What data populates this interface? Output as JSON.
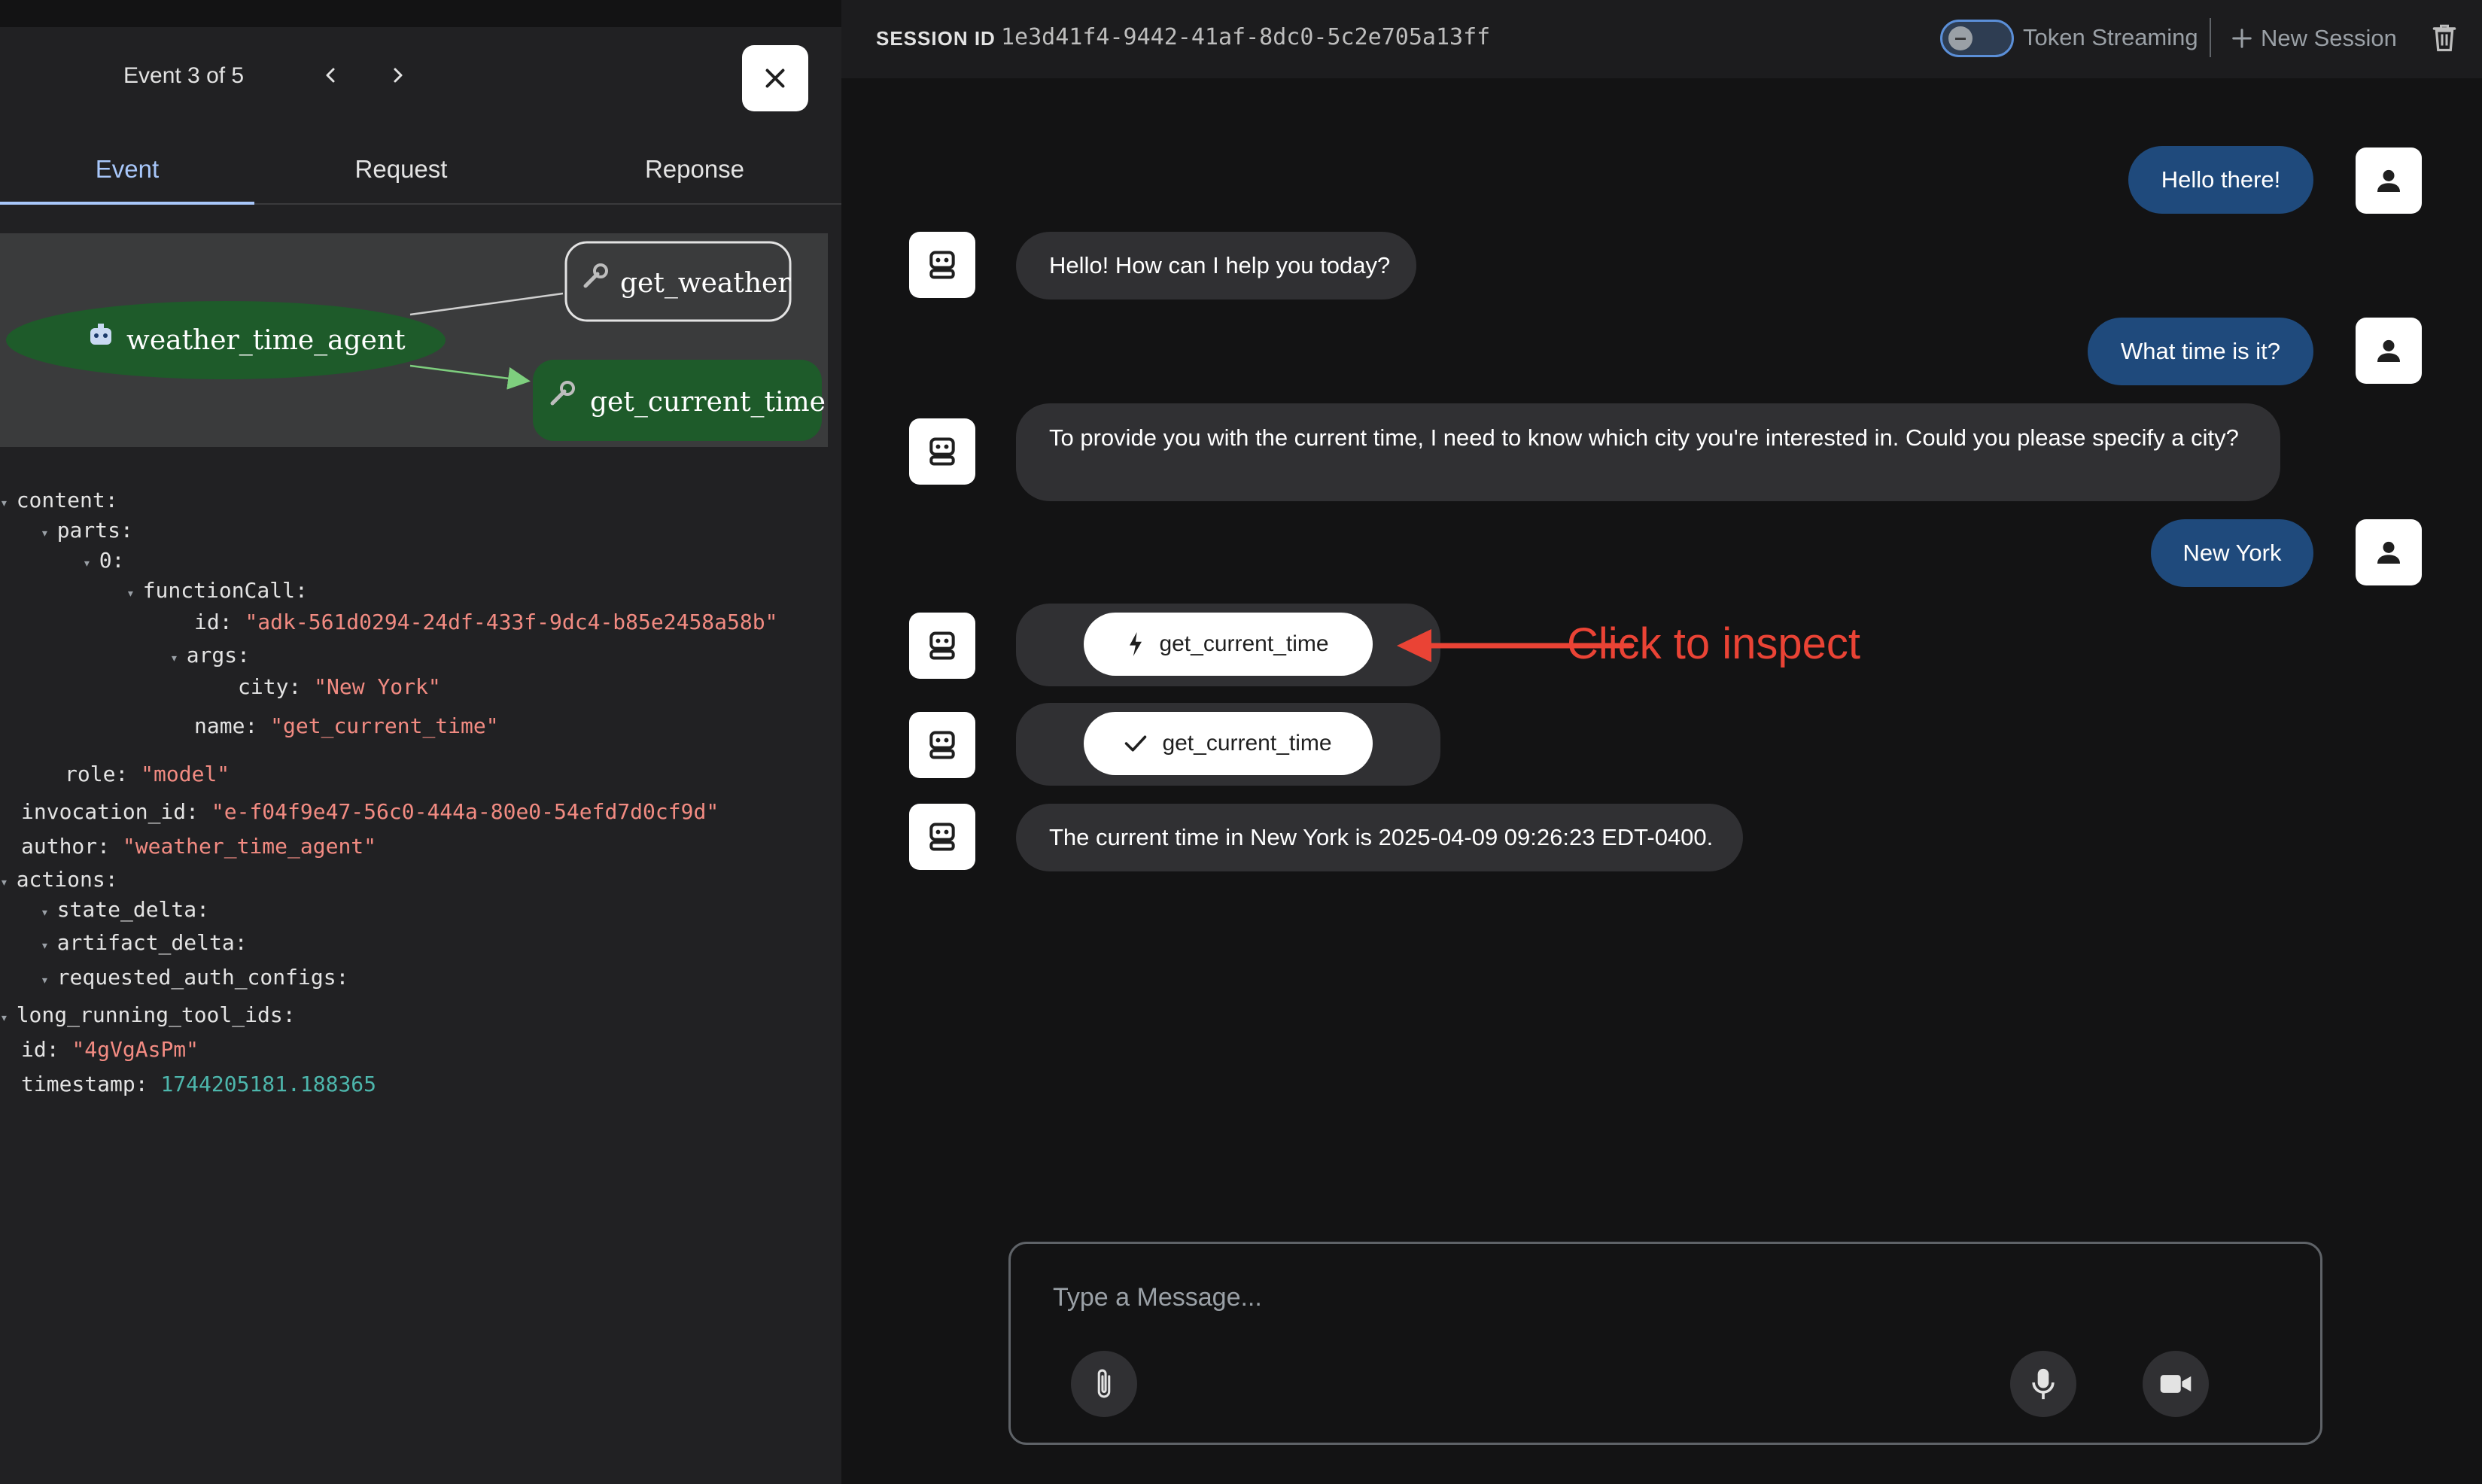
{
  "event_panel": {
    "counter": "Event 3 of 5",
    "tabs": [
      "Event",
      "Request",
      "Reponse"
    ],
    "graph": {
      "nodes": [
        "weather_time_agent",
        "get_weather",
        "get_current_time"
      ]
    },
    "json": {
      "content_key": "content:",
      "parts_key": "parts:",
      "index_key": "0:",
      "function_call_key": "functionCall:",
      "id_key": "id:",
      "id_val": "\"adk-561d0294-24df-433f-9dc4-b85e2458a58b\"",
      "args_key": "args:",
      "city_key": "city:",
      "city_val": "\"New York\"",
      "name_key": "name:",
      "name_val": "\"get_current_time\"",
      "role_key": "role:",
      "role_val": "\"model\"",
      "invocation_key": "invocation_id:",
      "invocation_val": "\"e-f04f9e47-56c0-444a-80e0-54efd7d0cf9d\"",
      "author_key": "author:",
      "author_val": "\"weather_time_agent\"",
      "actions_key": "actions:",
      "state_delta_key": "state_delta:",
      "artifact_delta_key": "artifact_delta:",
      "requested_auth_key": "requested_auth_configs:",
      "long_running_key": "long_running_tool_ids:",
      "event_id_key": "id:",
      "event_id_val": "\"4gVgAsPm\"",
      "timestamp_key": "timestamp:",
      "timestamp_val": "1744205181.188365"
    }
  },
  "header": {
    "session_label": "SESSION ID",
    "session_id": "1e3d41f4-9442-41af-8dc0-5c2e705a13ff",
    "streaming_label": "Token Streaming",
    "new_session_label": "New Session"
  },
  "chat": {
    "messages": [
      {
        "role": "user",
        "text": "Hello there!"
      },
      {
        "role": "bot",
        "text": "Hello! How can I help you today?"
      },
      {
        "role": "user",
        "text": "What time is it?"
      },
      {
        "role": "bot",
        "text": "To provide you with the current time, I need to know which city you're interested in. Could you please specify a city?"
      },
      {
        "role": "user",
        "text": "New York"
      },
      {
        "role": "bot-call",
        "text": "get_current_time"
      },
      {
        "role": "bot-response",
        "text": "get_current_time"
      },
      {
        "role": "bot",
        "text": "The current time in New York is 2025-04-09 09:26:23 EDT-0400."
      }
    ],
    "annotation": "Click to inspect"
  },
  "composer": {
    "placeholder": "Type a Message..."
  },
  "colors": {
    "accent": "#a8c7fa",
    "user_bubble": "#1f4a7c",
    "bot_bubble": "#303033",
    "graph_active_node": "#1e5b2a",
    "json_string": "#f28b82",
    "json_number": "#4db6ac",
    "annotation": "#ea4335"
  }
}
